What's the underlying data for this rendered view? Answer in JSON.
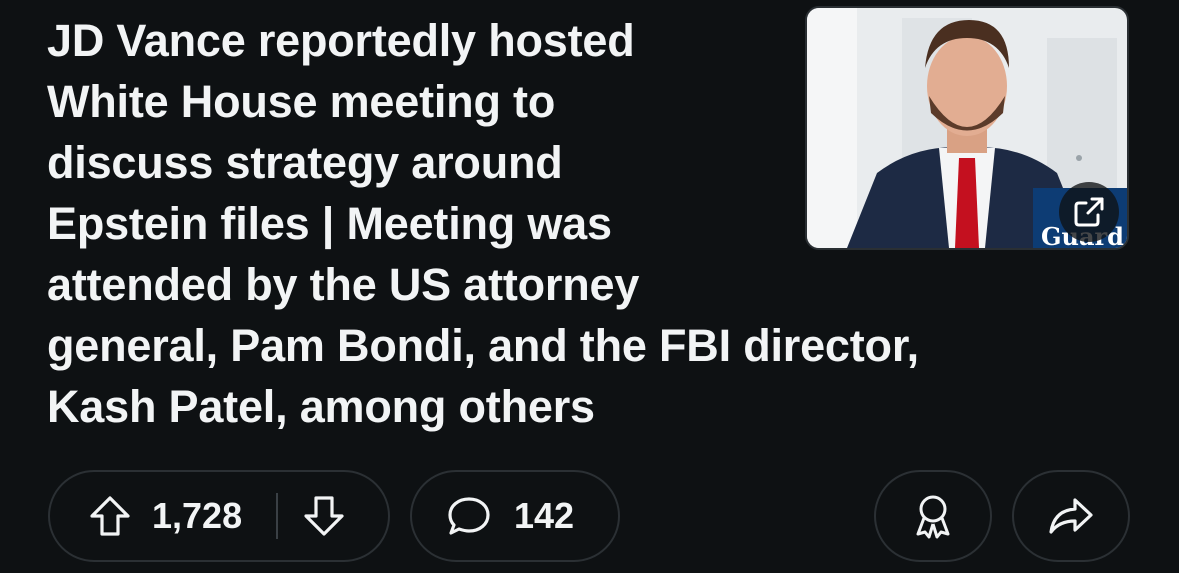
{
  "post": {
    "title": "JD Vance reportedly hosted\nWhite House meeting to\ndiscuss strategy around\nEpstein files | Meeting was\nattended by the US attorney\ngeneral, Pam Bondi, and the FBI director,\nKash Patel, among others",
    "thumbnail_brand": "Guard"
  },
  "actions": {
    "upvote_count": "1,728",
    "comment_count": "142"
  },
  "icons": {
    "upvote": "arrow-up-icon",
    "downvote": "arrow-down-icon",
    "comment": "speech-bubble-icon",
    "award": "award-ribbon-icon",
    "share": "share-arrow-icon",
    "external": "external-link-icon"
  },
  "colors": {
    "background": "#0e1113",
    "text": "#f2f4f5",
    "pill_border": "#2b3034"
  }
}
